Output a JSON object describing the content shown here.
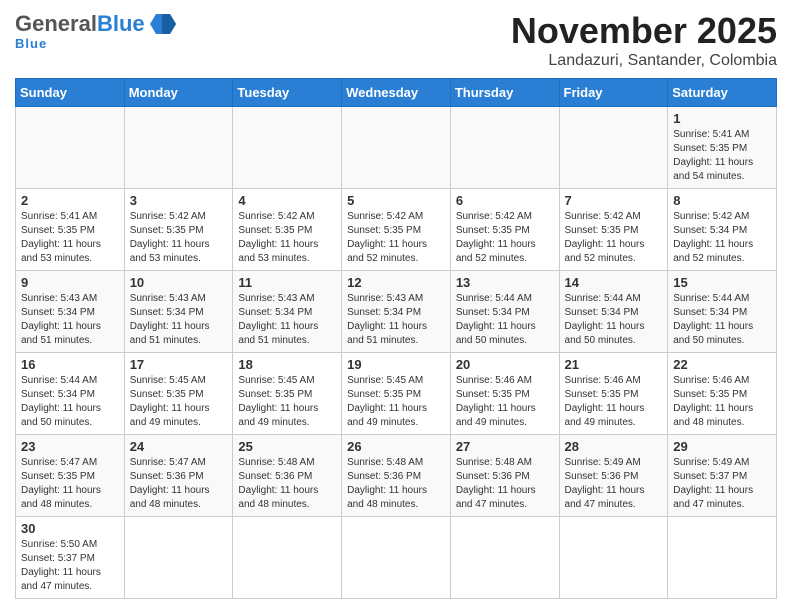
{
  "header": {
    "logo_general": "General",
    "logo_blue": "Blue",
    "month_title": "November 2025",
    "location": "Landazuri, Santander, Colombia"
  },
  "days_of_week": [
    "Sunday",
    "Monday",
    "Tuesday",
    "Wednesday",
    "Thursday",
    "Friday",
    "Saturday"
  ],
  "weeks": [
    [
      {
        "day": "",
        "info": ""
      },
      {
        "day": "",
        "info": ""
      },
      {
        "day": "",
        "info": ""
      },
      {
        "day": "",
        "info": ""
      },
      {
        "day": "",
        "info": ""
      },
      {
        "day": "",
        "info": ""
      },
      {
        "day": "1",
        "info": "Sunrise: 5:41 AM\nSunset: 5:35 PM\nDaylight: 11 hours\nand 54 minutes."
      }
    ],
    [
      {
        "day": "2",
        "info": "Sunrise: 5:41 AM\nSunset: 5:35 PM\nDaylight: 11 hours\nand 53 minutes."
      },
      {
        "day": "3",
        "info": "Sunrise: 5:42 AM\nSunset: 5:35 PM\nDaylight: 11 hours\nand 53 minutes."
      },
      {
        "day": "4",
        "info": "Sunrise: 5:42 AM\nSunset: 5:35 PM\nDaylight: 11 hours\nand 53 minutes."
      },
      {
        "day": "5",
        "info": "Sunrise: 5:42 AM\nSunset: 5:35 PM\nDaylight: 11 hours\nand 52 minutes."
      },
      {
        "day": "6",
        "info": "Sunrise: 5:42 AM\nSunset: 5:35 PM\nDaylight: 11 hours\nand 52 minutes."
      },
      {
        "day": "7",
        "info": "Sunrise: 5:42 AM\nSunset: 5:35 PM\nDaylight: 11 hours\nand 52 minutes."
      },
      {
        "day": "8",
        "info": "Sunrise: 5:42 AM\nSunset: 5:34 PM\nDaylight: 11 hours\nand 52 minutes."
      }
    ],
    [
      {
        "day": "9",
        "info": "Sunrise: 5:43 AM\nSunset: 5:34 PM\nDaylight: 11 hours\nand 51 minutes."
      },
      {
        "day": "10",
        "info": "Sunrise: 5:43 AM\nSunset: 5:34 PM\nDaylight: 11 hours\nand 51 minutes."
      },
      {
        "day": "11",
        "info": "Sunrise: 5:43 AM\nSunset: 5:34 PM\nDaylight: 11 hours\nand 51 minutes."
      },
      {
        "day": "12",
        "info": "Sunrise: 5:43 AM\nSunset: 5:34 PM\nDaylight: 11 hours\nand 51 minutes."
      },
      {
        "day": "13",
        "info": "Sunrise: 5:44 AM\nSunset: 5:34 PM\nDaylight: 11 hours\nand 50 minutes."
      },
      {
        "day": "14",
        "info": "Sunrise: 5:44 AM\nSunset: 5:34 PM\nDaylight: 11 hours\nand 50 minutes."
      },
      {
        "day": "15",
        "info": "Sunrise: 5:44 AM\nSunset: 5:34 PM\nDaylight: 11 hours\nand 50 minutes."
      }
    ],
    [
      {
        "day": "16",
        "info": "Sunrise: 5:44 AM\nSunset: 5:34 PM\nDaylight: 11 hours\nand 50 minutes."
      },
      {
        "day": "17",
        "info": "Sunrise: 5:45 AM\nSunset: 5:35 PM\nDaylight: 11 hours\nand 49 minutes."
      },
      {
        "day": "18",
        "info": "Sunrise: 5:45 AM\nSunset: 5:35 PM\nDaylight: 11 hours\nand 49 minutes."
      },
      {
        "day": "19",
        "info": "Sunrise: 5:45 AM\nSunset: 5:35 PM\nDaylight: 11 hours\nand 49 minutes."
      },
      {
        "day": "20",
        "info": "Sunrise: 5:46 AM\nSunset: 5:35 PM\nDaylight: 11 hours\nand 49 minutes."
      },
      {
        "day": "21",
        "info": "Sunrise: 5:46 AM\nSunset: 5:35 PM\nDaylight: 11 hours\nand 49 minutes."
      },
      {
        "day": "22",
        "info": "Sunrise: 5:46 AM\nSunset: 5:35 PM\nDaylight: 11 hours\nand 48 minutes."
      }
    ],
    [
      {
        "day": "23",
        "info": "Sunrise: 5:47 AM\nSunset: 5:35 PM\nDaylight: 11 hours\nand 48 minutes."
      },
      {
        "day": "24",
        "info": "Sunrise: 5:47 AM\nSunset: 5:36 PM\nDaylight: 11 hours\nand 48 minutes."
      },
      {
        "day": "25",
        "info": "Sunrise: 5:48 AM\nSunset: 5:36 PM\nDaylight: 11 hours\nand 48 minutes."
      },
      {
        "day": "26",
        "info": "Sunrise: 5:48 AM\nSunset: 5:36 PM\nDaylight: 11 hours\nand 48 minutes."
      },
      {
        "day": "27",
        "info": "Sunrise: 5:48 AM\nSunset: 5:36 PM\nDaylight: 11 hours\nand 47 minutes."
      },
      {
        "day": "28",
        "info": "Sunrise: 5:49 AM\nSunset: 5:36 PM\nDaylight: 11 hours\nand 47 minutes."
      },
      {
        "day": "29",
        "info": "Sunrise: 5:49 AM\nSunset: 5:37 PM\nDaylight: 11 hours\nand 47 minutes."
      }
    ],
    [
      {
        "day": "30",
        "info": "Sunrise: 5:50 AM\nSunset: 5:37 PM\nDaylight: 11 hours\nand 47 minutes."
      },
      {
        "day": "",
        "info": ""
      },
      {
        "day": "",
        "info": ""
      },
      {
        "day": "",
        "info": ""
      },
      {
        "day": "",
        "info": ""
      },
      {
        "day": "",
        "info": ""
      },
      {
        "day": "",
        "info": ""
      }
    ]
  ]
}
